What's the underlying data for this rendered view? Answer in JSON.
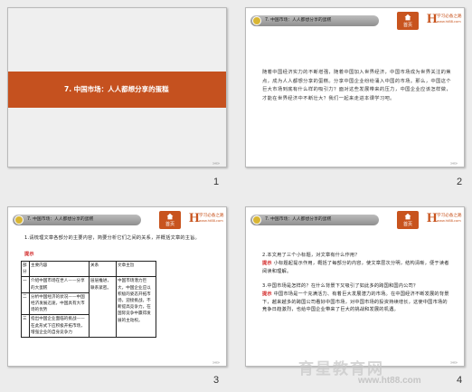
{
  "header": {
    "title": "7. 中国市场：人人都想分享的蛋糕",
    "home_label": "首页",
    "brand_mark": "H",
    "brand_line1": "学习必备之路",
    "brand_line2": "www.ht88.com"
  },
  "slides": [
    {
      "number": "1",
      "title": "7. 中国市场：人人都想分享的蛋糕",
      "corner": "»»»"
    },
    {
      "number": "2",
      "body": "随着中国经济实力的不断增强，随着中国加入世界经济，中国市场成为世界关注的焦点，成为人人都想分享的蛋糕。分享中国企业纷纷涌入中国的市场。那么，中国这个巨大市场到底有什么样的吸引力？面对这些发展带来的压力，中国企业应该怎样做，才能在世界经济中不断壮大？我们一起来走进本课学习吧。",
      "corner": "»»»"
    },
    {
      "number": "3",
      "question": "1.请梳理文章各部分的主要内容，简要分析它们之间的关系，并概括文章的主旨。",
      "hint_label": "提示",
      "table": {
        "headers": [
          "部分",
          "主要内容",
          "关系",
          "文章主旨"
        ],
        "rows": [
          [
            "一",
            "介绍中国市场在世人——分享的大蛋糕"
          ],
          [
            "二",
            "分析中国经济的状况——中国经济发展迅速，中国具有大市场的优势"
          ],
          [
            "三",
            "指出中国企业面临的挑战——在此形式下应积极开拓市场，增强企业的自身竞争力"
          ]
        ],
        "relation": "层层推进，联系紧密。",
        "theme": "中国市场潜力巨大，中国企业应以积极的姿态开拓市场，迎接挑战，不断提高竞争力，在国际竞争中赢得发展的主动权。"
      },
      "corner": "»»»"
    },
    {
      "number": "4",
      "q2": "2.本文用了三个小标题，对文章有什么作用？",
      "hint_label": "提示",
      "a2": "小标题起提示作用，概括了每部分的内容，使文章层次分明，结构清晰，便于读者阅读和理解。",
      "q3": "3.中国市场是怎样的？在什么背景下又吸引了如此多的跨国和国内公司？",
      "a3": "中国市场是一个充满活力、有着巨大发展潜力的市场。在中国经济不断发展的背景下，越来越多的跨国公司看好中国市场，对中国市场的投资持续增长，这使中国市场的竞争日趋激烈，也给中国企业带来了巨大的挑战和发展的机遇。",
      "corner": "»»»"
    }
  ],
  "watermark": {
    "text": "育星教育网",
    "url": "www.ht88.com"
  },
  "colors": {
    "accent": "#c5511f",
    "hint": "#d02020"
  }
}
